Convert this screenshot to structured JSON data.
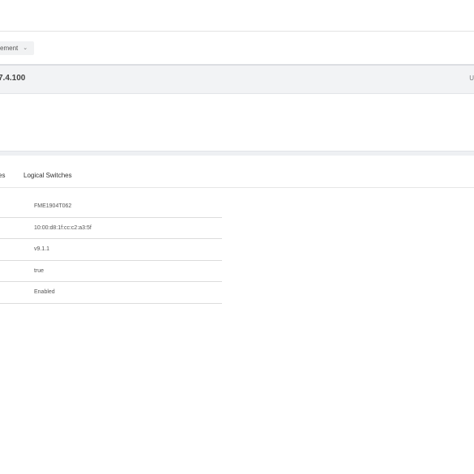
{
  "toolbar": {
    "management_dropdown_label": "ement"
  },
  "device": {
    "ip_partial": "7.4.100",
    "right_text_partial": "U"
  },
  "tabs": [
    {
      "label": "ses"
    },
    {
      "label": "Logical Switches"
    }
  ],
  "properties": [
    {
      "value": "FME1904T062"
    },
    {
      "value": "10:00:d8:1f:cc:c2:a3:5f"
    },
    {
      "value": "v9.1.1"
    },
    {
      "value": "true"
    },
    {
      "value": "Enabled"
    }
  ],
  "colors": {
    "header_bg": "#f2f3f5",
    "separator_bg": "#eef0f3",
    "dropdown_bg": "#f1f2f3"
  }
}
